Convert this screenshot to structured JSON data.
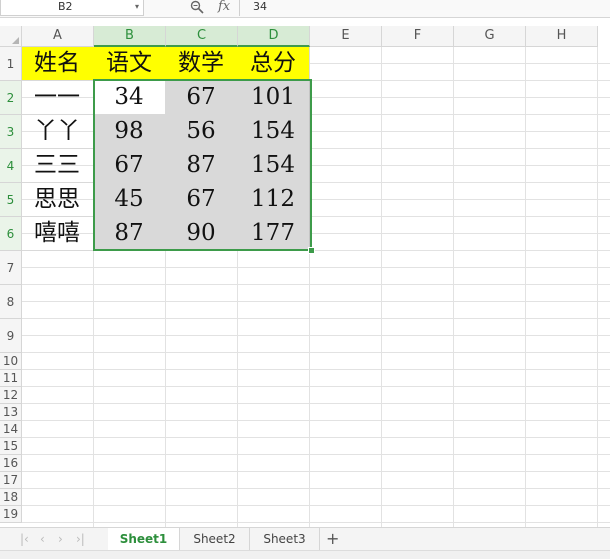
{
  "formula_bar": {
    "name_box": "B2",
    "fx_label": "fx",
    "value": "34"
  },
  "columns": [
    "A",
    "B",
    "C",
    "D",
    "E",
    "F",
    "G",
    "H"
  ],
  "rows": [
    "1",
    "2",
    "3",
    "4",
    "5",
    "6",
    "7",
    "8",
    "9",
    "10",
    "11",
    "12",
    "13",
    "14",
    "15",
    "16",
    "17",
    "18",
    "19"
  ],
  "table": {
    "headers": [
      "姓名",
      "语文",
      "数学",
      "总分"
    ],
    "records": [
      [
        "一一",
        "34",
        "67",
        "101"
      ],
      [
        "丫丫",
        "98",
        "56",
        "154"
      ],
      [
        "三三",
        "67",
        "87",
        "154"
      ],
      [
        "思思",
        "45",
        "67",
        "112"
      ],
      [
        "嘻嘻",
        "87",
        "90",
        "177"
      ]
    ]
  },
  "selection": {
    "active_cell": "B2",
    "range": "B2:D6"
  },
  "sheet_tabs": {
    "tabs": [
      "Sheet1",
      "Sheet2",
      "Sheet3"
    ],
    "active": "Sheet1",
    "add_label": "+"
  },
  "colors": {
    "header_fill": "#ffff00",
    "selection_fill": "#d9d9d9",
    "selection_border": "#3d9b4a",
    "active_tab_text": "#2d8f3c"
  },
  "icons": {
    "zoom": "zoom-icon",
    "name_box_dropdown": "chevron-down-icon"
  }
}
